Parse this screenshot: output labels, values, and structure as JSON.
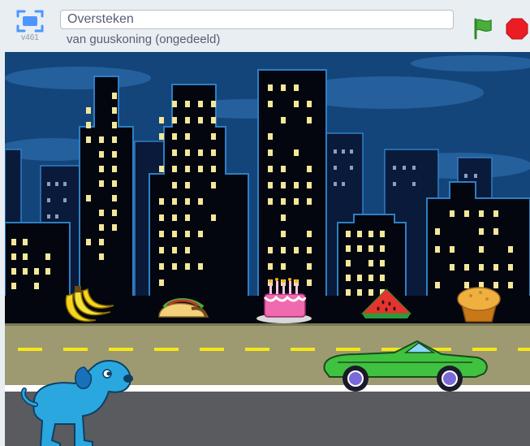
{
  "header": {
    "title": "Oversteken",
    "author_line": "van guuskoning (ongedeeld)",
    "version": "v461"
  },
  "controls": {
    "fullscreen_icon": "fullscreen-icon",
    "green_flag_icon": "green-flag-icon",
    "stop_icon": "stop-icon"
  },
  "stage": {
    "sprites": [
      "bananas",
      "taco",
      "birthday-cake",
      "watermelon",
      "muffin",
      "car",
      "dog"
    ],
    "colors": {
      "sky": "#13457a",
      "road": "#9d9a72",
      "lane_marking": "#f5e61a",
      "car": "#3fc23f",
      "dog": "#2aa7de"
    }
  }
}
